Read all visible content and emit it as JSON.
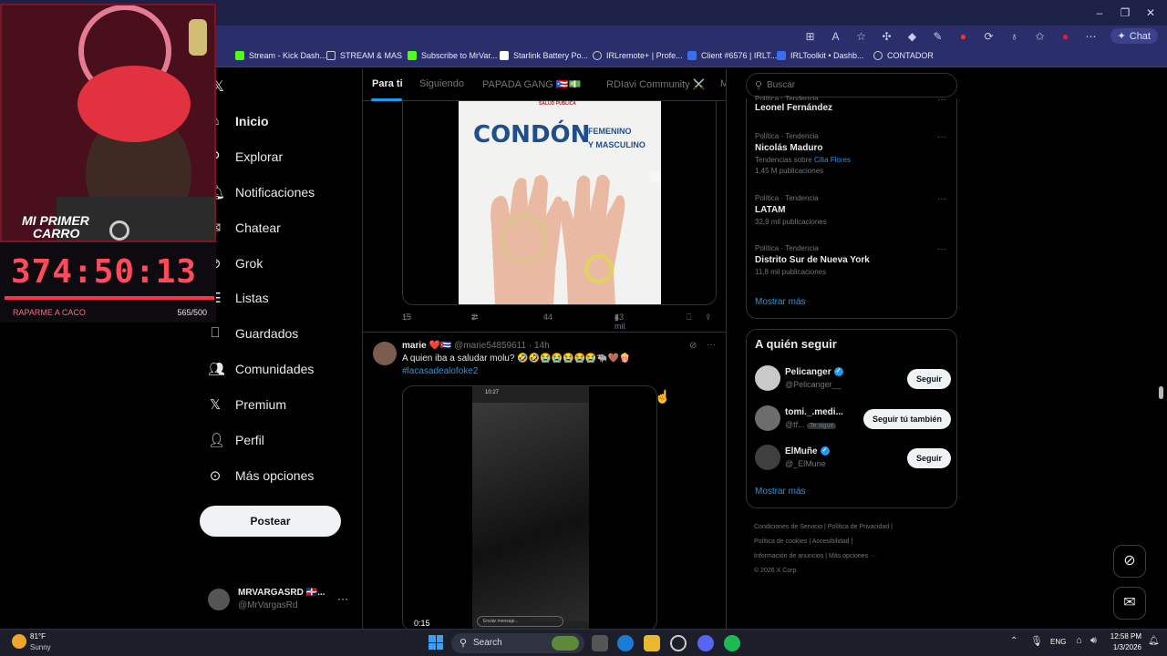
{
  "browser": {
    "bookmarks": [
      {
        "label": "Stream - Kick Dash...",
        "color": "#53fc18"
      },
      {
        "label": "STREAM & MAS",
        "color": "#e7e8f6"
      },
      {
        "label": "Subscribe to MrVar...",
        "color": "#53fc18"
      },
      {
        "label": "Starlink Battery Po...",
        "color": "#ffffff"
      },
      {
        "label": "IRLremote+ | Profe...",
        "color": "#e7e8f6"
      },
      {
        "label": "Client #6576 | IRLT...",
        "color": "#3b6df0"
      },
      {
        "label": "IRLToolkit • Dashb...",
        "color": "#3b6df0"
      },
      {
        "label": "CONTADOR",
        "color": "#e7e8f6"
      }
    ],
    "chat_label": "Chat"
  },
  "sidebar": {
    "items": [
      {
        "label": "Inicio",
        "icon": "home-icon"
      },
      {
        "label": "Explorar",
        "icon": "search-icon"
      },
      {
        "label": "Notificaciones",
        "icon": "bell-icon"
      },
      {
        "label": "Chatear",
        "icon": "chat-icon"
      },
      {
        "label": "Grok",
        "icon": "grok-icon"
      },
      {
        "label": "Listas",
        "icon": "list-icon"
      },
      {
        "label": "Guardados",
        "icon": "bookmark-icon"
      },
      {
        "label": "Comunidades",
        "icon": "community-icon"
      },
      {
        "label": "Premium",
        "icon": "x-logo-icon"
      },
      {
        "label": "Perfil",
        "icon": "person-icon"
      },
      {
        "label": "Más opciones",
        "icon": "more-circle-icon"
      }
    ],
    "post_label": "Postear",
    "profile": {
      "name": "MRVARGASRD 🇩🇴...",
      "handle": "@MrVargasRd"
    }
  },
  "timeline": {
    "tabs": [
      "Para ti",
      "Siguiendo",
      "PAPADA GANG 🇵🇷💵",
      "RDIavi Community ⚔️",
      "M"
    ],
    "tweet1": {
      "poster_header": "SALUD PÚBLICA",
      "poster_title": "CONDÓN",
      "poster_sub1": "FEMENINO",
      "poster_sub2": "Y MASCULINO",
      "replies": "15",
      "reposts": "2",
      "likes": "44",
      "views": "43 mil"
    },
    "tweet2": {
      "name": "marie ❤️🇨🇺",
      "handle": "@marie54859611",
      "time": "· 14h",
      "text": "A quien iba a saludar molu? 🤣🤣😭😭😭😭😭🐃🤎🍿",
      "hashtag": "#lacasadealofoke2",
      "video_time": "0:15",
      "phone_clock": "10:27",
      "phone_input": "Enviar mensaje..."
    }
  },
  "right": {
    "search_placeholder": "Buscar",
    "trends": [
      {
        "cat": "Política · Tendencia",
        "name": "Leonel Fernández",
        "sub": ""
      },
      {
        "cat": "Política · Tendencia",
        "name": "Nicolás Maduro",
        "sub": "Tendencias sobre",
        "sub_link": "Cilia Flores",
        "count": "1,45 M publicaciones"
      },
      {
        "cat": "Política · Tendencia",
        "name": "LATAM",
        "count": "32,9 mil publicaciones"
      },
      {
        "cat": "Política · Tendencia",
        "name": "Distrito Sur de Nueva York",
        "count": "11,8 mil publicaciones"
      }
    ],
    "trends_more": "Mostrar más",
    "wtf_title": "A quién seguir",
    "wtf": [
      {
        "name": "Pelicanger",
        "handle": "@Pelicanger__",
        "button": "Seguir",
        "verified": true
      },
      {
        "name": "tomi._.medi...",
        "handle": "@tf...",
        "badge": "Te sigue",
        "button": "Seguir tú también",
        "verified": false
      },
      {
        "name": "ElMuñe",
        "handle": "@_ElMune",
        "button": "Seguir",
        "verified": true
      }
    ],
    "wtf_more": "Mostrar más",
    "footer": [
      "Condiciones de Servicio",
      "Política de Privacidad",
      "Política de cookies",
      "Accesibilidad",
      "Información de anuncios",
      "Más opciones ···",
      "© 2026 X Corp."
    ]
  },
  "stream": {
    "banner_line1": "MI PRIMER",
    "banner_line2": "CARRO",
    "timer": "374:50:13",
    "goal_label": "RAPARME A CACO",
    "goal_count": "565/500",
    "goal_progress": 1.0
  },
  "taskbar": {
    "weather_temp": "81°F",
    "weather_desc": "Sunny",
    "search_label": "Search",
    "lang": "ENG",
    "time": "12:58 PM",
    "date": "1/3/2026"
  },
  "colors": {
    "accent": "#1d9bf0",
    "timer": "#ff4b5c",
    "browser": "#2a2f6b"
  }
}
